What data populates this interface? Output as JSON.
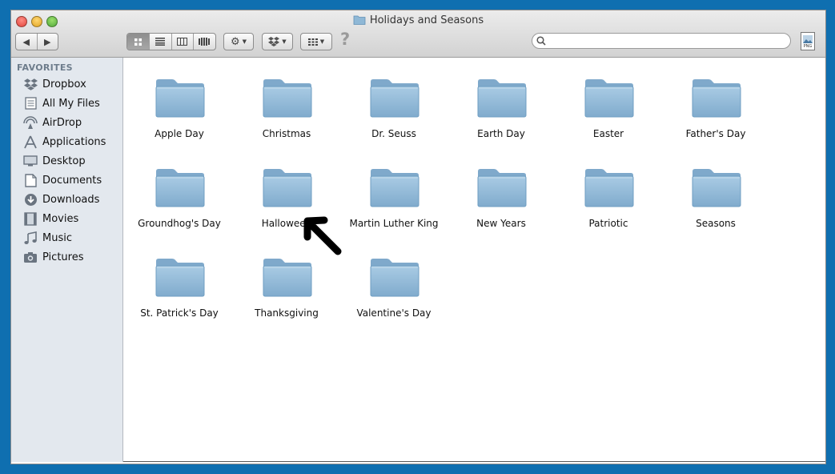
{
  "window": {
    "title": "Holidays and Seasons"
  },
  "search": {
    "placeholder": "",
    "value": ""
  },
  "toolbar": {
    "help": "?",
    "png_label": "PNG"
  },
  "sidebar": {
    "heading": "FAVORITES",
    "items": [
      {
        "label": "Dropbox",
        "icon": "dropbox-icon"
      },
      {
        "label": "All My Files",
        "icon": "all-files-icon"
      },
      {
        "label": "AirDrop",
        "icon": "airdrop-icon"
      },
      {
        "label": "Applications",
        "icon": "applications-icon"
      },
      {
        "label": "Desktop",
        "icon": "desktop-icon"
      },
      {
        "label": "Documents",
        "icon": "documents-icon"
      },
      {
        "label": "Downloads",
        "icon": "downloads-icon"
      },
      {
        "label": "Movies",
        "icon": "movies-icon"
      },
      {
        "label": "Music",
        "icon": "music-icon"
      },
      {
        "label": "Pictures",
        "icon": "pictures-icon"
      }
    ]
  },
  "folders": [
    {
      "name": "Apple Day"
    },
    {
      "name": "Christmas"
    },
    {
      "name": "Dr. Seuss"
    },
    {
      "name": "Earth Day"
    },
    {
      "name": "Easter"
    },
    {
      "name": "Father's Day"
    },
    {
      "name": "Groundhog's Day"
    },
    {
      "name": "Halloween"
    },
    {
      "name": "Martin Luther King"
    },
    {
      "name": "New Years"
    },
    {
      "name": "Patriotic"
    },
    {
      "name": "Seasons"
    },
    {
      "name": "St. Patrick's Day"
    },
    {
      "name": "Thanksgiving"
    },
    {
      "name": "Valentine's Day"
    }
  ],
  "colors": {
    "folder": "#8fb8d6",
    "folder_dark": "#6f9ec2",
    "border": "#0f6fb0"
  }
}
